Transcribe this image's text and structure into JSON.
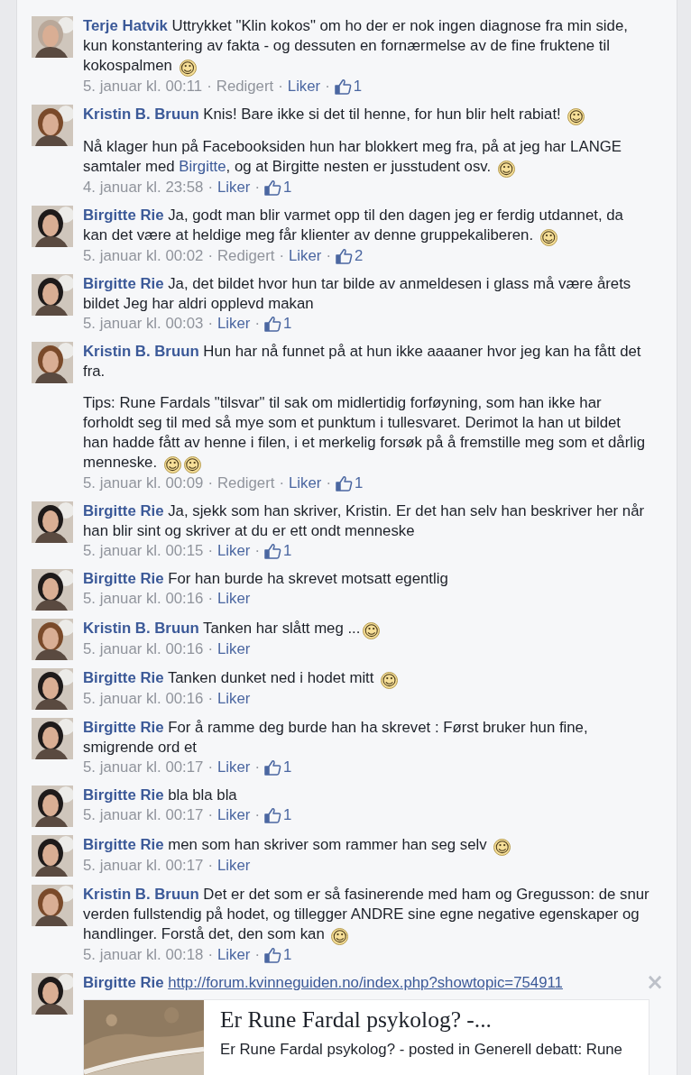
{
  "comments": [
    {
      "author": "Terje Hatvik",
      "avatar": {
        "kind": "picture",
        "color": "#b9a89a"
      },
      "paragraphs": [
        {
          "parts": [
            {
              "kind": "text",
              "text": "Uttrykket \"Klin kokos\" om ho der er nok ingen diagnose fra min side, kun konstantering av fakta - og dessuten en fornærmelse av de fine fruktene til kokospalmen "
            },
            {
              "kind": "smiley",
              "text": "☺"
            }
          ]
        }
      ],
      "meta": [
        {
          "kind": "time",
          "text": "5. januar kl. 00:11"
        },
        {
          "kind": "edited",
          "sep": "·",
          "text": "Redigert"
        },
        {
          "kind": "like",
          "sep": "·",
          "text": "Liker"
        },
        {
          "kind": "likes",
          "sep": "·",
          "text": "1"
        }
      ]
    },
    {
      "author": "Kristin B. Bruun",
      "avatar": {
        "kind": "picture",
        "color": "#7a4a2a"
      },
      "paragraphs": [
        {
          "parts": [
            {
              "kind": "text",
              "text": "Knis! Bare ikke si det til henne, for hun blir helt rabiat! "
            },
            {
              "kind": "smiley",
              "text": "☺"
            }
          ]
        },
        {
          "parts": [
            {
              "kind": "text",
              "text": "Nå klager hun på Facebooksiden hun har blokkert meg fra, på at jeg har LANGE samtaler med "
            },
            {
              "kind": "link",
              "text": "Birgitte"
            },
            {
              "kind": "text",
              "text": ", og at Birgitte nesten er jusstudent osv. "
            },
            {
              "kind": "smiley",
              "text": "☺"
            }
          ]
        }
      ],
      "meta": [
        {
          "kind": "time",
          "text": "4. januar kl. 23:58"
        },
        {
          "kind": "like",
          "sep": "·",
          "text": "Liker"
        },
        {
          "kind": "likes",
          "sep": "·",
          "text": "1"
        }
      ]
    },
    {
      "author": "Birgitte Rie",
      "avatar": {
        "kind": "picture",
        "color": "#1e1a1a"
      },
      "paragraphs": [
        {
          "parts": [
            {
              "kind": "text",
              "text": "Ja, godt man blir varmet opp til den dagen jeg er ferdig utdannet, da kan det være at heldige meg får klienter av denne gruppekaliberen. "
            },
            {
              "kind": "smiley",
              "text": "☺"
            }
          ]
        }
      ],
      "meta": [
        {
          "kind": "time",
          "text": "5. januar kl. 00:02"
        },
        {
          "kind": "edited",
          "sep": "·",
          "text": "Redigert"
        },
        {
          "kind": "like",
          "sep": "·",
          "text": "Liker"
        },
        {
          "kind": "likes",
          "sep": "·",
          "text": "2"
        }
      ]
    },
    {
      "author": "Birgitte Rie",
      "avatar": {
        "kind": "picture",
        "color": "#1e1a1a"
      },
      "paragraphs": [
        {
          "parts": [
            {
              "kind": "text",
              "text": "Ja, det bildet hvor hun tar bilde av anmeldesen i glass må være årets bildet Jeg har aldri opplevd makan"
            }
          ]
        }
      ],
      "meta": [
        {
          "kind": "time",
          "text": "5. januar kl. 00:03"
        },
        {
          "kind": "like",
          "sep": "·",
          "text": "Liker"
        },
        {
          "kind": "likes",
          "sep": "·",
          "text": "1"
        }
      ]
    },
    {
      "author": "Kristin B. Bruun",
      "avatar": {
        "kind": "picture",
        "color": "#7a4a2a"
      },
      "paragraphs": [
        {
          "parts": [
            {
              "kind": "text",
              "text": "Hun har nå funnet på at hun ikke aaaaner hvor jeg kan ha fått det fra."
            }
          ]
        },
        {
          "parts": [
            {
              "kind": "text",
              "text": "Tips: Rune Fardals \"tilsvar\" til sak om midlertidig forføyning, som han ikke har forholdt seg til med så mye som et punktum i tullesvaret. Derimot la han ut bildet han hadde fått av henne i filen, i et merkelig forsøk på å fremstille meg som et dårlig menneske. "
            },
            {
              "kind": "smiley",
              "text": "☺"
            },
            {
              "kind": "smiley",
              "text": "☺"
            }
          ]
        }
      ],
      "meta": [
        {
          "kind": "time",
          "text": "5. januar kl. 00:09"
        },
        {
          "kind": "edited",
          "sep": "·",
          "text": "Redigert"
        },
        {
          "kind": "like",
          "sep": "·",
          "text": "Liker"
        },
        {
          "kind": "likes",
          "sep": "·",
          "text": "1"
        }
      ]
    },
    {
      "author": "Birgitte Rie",
      "avatar": {
        "kind": "picture",
        "color": "#1e1a1a"
      },
      "paragraphs": [
        {
          "parts": [
            {
              "kind": "text",
              "text": "Ja, sjekk som han skriver, Kristin. Er det han selv han beskriver her når han blir sint og skriver at du er ett ondt menneske"
            }
          ]
        }
      ],
      "meta": [
        {
          "kind": "time",
          "text": "5. januar kl. 00:15"
        },
        {
          "kind": "like",
          "sep": "·",
          "text": "Liker"
        },
        {
          "kind": "likes",
          "sep": "·",
          "text": "1"
        }
      ]
    },
    {
      "author": "Birgitte Rie",
      "avatar": {
        "kind": "picture",
        "color": "#1e1a1a"
      },
      "paragraphs": [
        {
          "parts": [
            {
              "kind": "text",
              "text": "For han burde ha skrevet motsatt egentlig"
            }
          ]
        }
      ],
      "meta": [
        {
          "kind": "time",
          "text": "5. januar kl. 00:16"
        },
        {
          "kind": "like",
          "sep": "·",
          "text": "Liker"
        }
      ]
    },
    {
      "author": "Kristin B. Bruun",
      "avatar": {
        "kind": "picture",
        "color": "#7a4a2a"
      },
      "paragraphs": [
        {
          "parts": [
            {
              "kind": "text",
              "text": "Tanken har slått meg ..."
            },
            {
              "kind": "smiley",
              "text": "☺"
            }
          ]
        }
      ],
      "meta": [
        {
          "kind": "time",
          "text": "5. januar kl. 00:16"
        },
        {
          "kind": "like",
          "sep": "·",
          "text": "Liker"
        }
      ]
    },
    {
      "author": "Birgitte Rie",
      "avatar": {
        "kind": "picture",
        "color": "#1e1a1a"
      },
      "paragraphs": [
        {
          "parts": [
            {
              "kind": "text",
              "text": "Tanken dunket ned i hodet mitt "
            },
            {
              "kind": "smiley",
              "text": "☺"
            }
          ]
        }
      ],
      "meta": [
        {
          "kind": "time",
          "text": "5. januar kl. 00:16"
        },
        {
          "kind": "like",
          "sep": "·",
          "text": "Liker"
        }
      ]
    },
    {
      "author": "Birgitte Rie",
      "avatar": {
        "kind": "picture",
        "color": "#1e1a1a"
      },
      "paragraphs": [
        {
          "parts": [
            {
              "kind": "text",
              "text": "For å ramme deg burde han ha skrevet : Først bruker hun fine, smigrende ord et"
            }
          ]
        }
      ],
      "meta": [
        {
          "kind": "time",
          "text": "5. januar kl. 00:17"
        },
        {
          "kind": "like",
          "sep": "·",
          "text": "Liker"
        },
        {
          "kind": "likes",
          "sep": "·",
          "text": "1"
        }
      ]
    },
    {
      "author": "Birgitte Rie",
      "avatar": {
        "kind": "picture",
        "color": "#1e1a1a"
      },
      "paragraphs": [
        {
          "parts": [
            {
              "kind": "text",
              "text": "bla bla bla"
            }
          ]
        }
      ],
      "meta": [
        {
          "kind": "time",
          "text": "5. januar kl. 00:17"
        },
        {
          "kind": "like",
          "sep": "·",
          "text": "Liker"
        },
        {
          "kind": "likes",
          "sep": "·",
          "text": "1"
        }
      ]
    },
    {
      "author": "Birgitte Rie",
      "avatar": {
        "kind": "picture",
        "color": "#1e1a1a"
      },
      "paragraphs": [
        {
          "parts": [
            {
              "kind": "text",
              "text": "men som han skriver som rammer han seg selv "
            },
            {
              "kind": "smiley",
              "text": "☺"
            }
          ]
        }
      ],
      "meta": [
        {
          "kind": "time",
          "text": "5. januar kl. 00:17"
        },
        {
          "kind": "like",
          "sep": "·",
          "text": "Liker"
        }
      ]
    },
    {
      "author": "Kristin B. Bruun",
      "avatar": {
        "kind": "picture",
        "color": "#7a4a2a"
      },
      "paragraphs": [
        {
          "parts": [
            {
              "kind": "text",
              "text": "Det er det som er så fasinerende med ham og Gregusson: de snur verden fullstendig på hodet, og tillegger ANDRE sine egne negative egenskaper og handlinger. Forstå det, den som kan "
            },
            {
              "kind": "smiley",
              "text": "☺"
            }
          ]
        }
      ],
      "meta": [
        {
          "kind": "time",
          "text": "5. januar kl. 00:18"
        },
        {
          "kind": "like",
          "sep": "·",
          "text": "Liker"
        },
        {
          "kind": "likes",
          "sep": "·",
          "text": "1"
        }
      ]
    },
    {
      "author": "Birgitte Rie",
      "avatar": {
        "kind": "picture",
        "color": "#1e1a1a"
      },
      "close": "×",
      "paragraphs": [
        {
          "parts": [
            {
              "kind": "url",
              "text": "http://forum.kvinneguiden.no/index.php?showtopic=754911"
            }
          ]
        }
      ],
      "preview": {
        "kind": "picture",
        "title": "Er Rune Fardal psykolog? -...",
        "description": "Er Rune Fardal psykolog? - posted in Generell debatt: Rune"
      }
    }
  ]
}
